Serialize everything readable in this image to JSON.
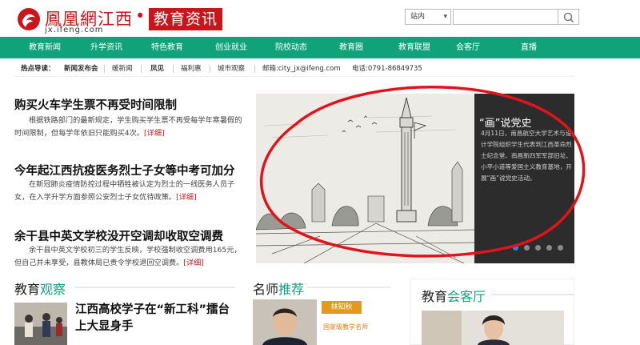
{
  "header": {
    "logo_text": "鳳凰網江西",
    "logo_url": "jx.ifeng.com",
    "separator": "•",
    "section_badge": "教育资讯",
    "search": {
      "scope_value": "站内",
      "input_value": "",
      "button_icon": "search-icon"
    }
  },
  "nav": {
    "items": [
      "教育新闻",
      "升学资讯",
      "特色教育",
      "创业就业",
      "院校动态",
      "教育圈",
      "教育联盟",
      "会客厅",
      "直播"
    ]
  },
  "hotbar": {
    "label": "热点导读：",
    "items": [
      "新闻发布会",
      "暖新闻",
      "凤见",
      "福利惠",
      "城市观察"
    ],
    "email": "邮箱:city_jx@ifeng.com",
    "phone": "电话:0791-86849735"
  },
  "news": [
    {
      "title": "购买火车学生票不再受时间限制",
      "desc": "根据铁路部门的最新规定，学生购买学生票不再受每学年寒暑假的时间限制，但每学年依旧只能购买4次。",
      "more": "[详细]"
    },
    {
      "title": "今年起江西抗疫医务烈士子女等中考可加分",
      "desc": "在新冠肺炎疫情防控过程中牺牲被认定为烈士的一线医务人员子女，在入学升学方面参照公安烈士子女优待政策。",
      "more": "[详细]"
    },
    {
      "title": "余干县中英文学校没开空调却收取空调费",
      "desc": "余干县中英文学校初三的学生反映，学校强制收空调费用165元，但自己并未享受，县教体局已责令学校退回空调费。",
      "more": "[详细]"
    }
  ],
  "slider": {
    "title": "“画”说党史",
    "desc": "4月11日，南昌航空大学艺术与设计学院组织学生代表到江西革命烈士纪念堂、南昌新四军军部旧址、小平小道等爱国主义教育基地，开展“画”说党史活动。",
    "dots_count": 5,
    "active_dot": 1
  },
  "sections": {
    "edu_observe": {
      "prefix": "教育",
      "highlight": "观察"
    },
    "teacher": {
      "prefix": "名师",
      "highlight": "推荐",
      "name": "林知秋",
      "desc": "国家级教学名师"
    },
    "parlor": {
      "prefix": "教育",
      "highlight": "会客厅"
    }
  },
  "observe_headline": "江西高校学子在“新工科”擂台上大显身手",
  "colors": {
    "brand_red": "#c8161d",
    "nav_green": "#10a37a",
    "annotation_red": "#e0141a",
    "active_dot": "#1e88e5"
  }
}
